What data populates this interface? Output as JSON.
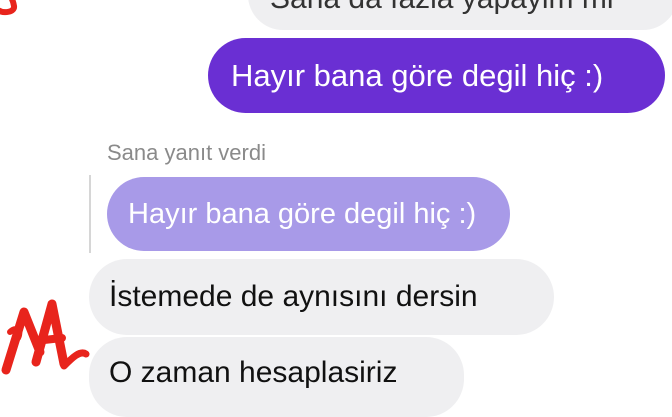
{
  "conversation": {
    "messages": [
      {
        "text": "Sana da fazla yapayim mi"
      },
      {
        "text": "Hayır bana göre degil hiç :)"
      },
      {
        "reply_label": "Sana yanıt verdi",
        "quoted_text": "Hayır bana göre degil hiç :)"
      },
      {
        "text": "İstemede de aynısını dersin"
      },
      {
        "text": "O zaman hesaplasiriz"
      }
    ]
  },
  "colors": {
    "outgoing_bubble": "#6a2fd3",
    "quoted_bubble": "#a89ae8",
    "incoming_bubble": "#efeff1",
    "scribble": "#e8241c"
  },
  "icons": [
    "red-scribble-annotation"
  ]
}
